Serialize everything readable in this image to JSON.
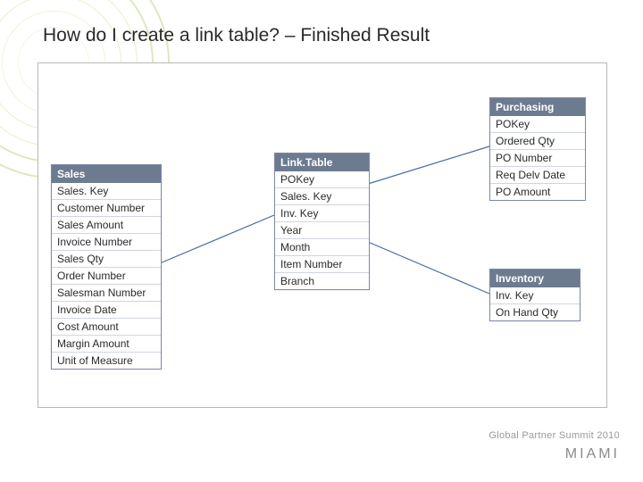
{
  "title": "How do I create a link table? – Finished Result",
  "tables": {
    "sales": {
      "name": "Sales",
      "fields": [
        "Sales. Key",
        "Customer Number",
        "Sales Amount",
        "Invoice Number",
        "Sales Qty",
        "Order Number",
        "Salesman Number",
        "Invoice Date",
        "Cost Amount",
        "Margin Amount",
        "Unit of Measure"
      ]
    },
    "linktable": {
      "name": "Link.Table",
      "fields": [
        "POKey",
        "Sales. Key",
        "Inv. Key",
        "Year",
        "Month",
        "Item Number",
        "Branch"
      ]
    },
    "purchasing": {
      "name": "Purchasing",
      "fields": [
        "POKey",
        "Ordered Qty",
        "PO Number",
        "Req Delv Date",
        "PO Amount"
      ]
    },
    "inventory": {
      "name": "Inventory",
      "fields": [
        "Inv. Key",
        "On Hand Qty"
      ]
    }
  },
  "links": [
    {
      "from": "sales",
      "to": "linktable"
    },
    {
      "from": "linktable",
      "to": "purchasing"
    },
    {
      "from": "linktable",
      "to": "inventory"
    }
  ],
  "footer": {
    "summit": "Global Partner Summit 2010",
    "miami": "MIAMI"
  },
  "colors": {
    "headerBg": "#6d7b90",
    "headerText": "#ffffff",
    "border": "#7c8aa8",
    "link": "#4a6aa8",
    "swirl": "#9ec24d"
  }
}
